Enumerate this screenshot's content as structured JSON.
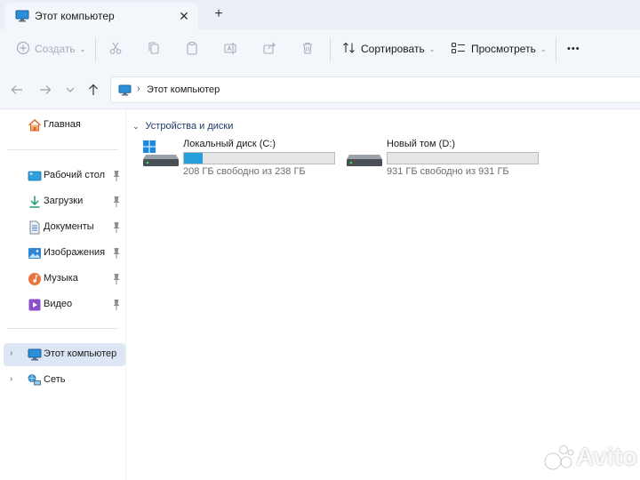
{
  "window": {
    "tab_title": "Этот компьютер",
    "tab_close": "✕",
    "new_tab": "+"
  },
  "toolbar": {
    "create_label": "Создать",
    "sort_label": "Сортировать",
    "view_label": "Просмотреть",
    "more_label": "•••"
  },
  "address": {
    "path": "Этот компьютер"
  },
  "sidebar": {
    "home": "Главная",
    "quick_access": [
      {
        "label": "Рабочий стол"
      },
      {
        "label": "Загрузки"
      },
      {
        "label": "Документы"
      },
      {
        "label": "Изображения"
      },
      {
        "label": "Музыка"
      },
      {
        "label": "Видео"
      }
    ],
    "this_pc": "Этот компьютер",
    "network": "Сеть"
  },
  "content": {
    "group_title": "Устройства и диски",
    "drives": [
      {
        "name": "Локальный диск (C:)",
        "free_text": "208 ГБ свободно из 238 ГБ",
        "used_fraction": 0.126
      },
      {
        "name": "Новый том (D:)",
        "free_text": "931 ГБ свободно из 931 ГБ",
        "used_fraction": 0.0
      }
    ]
  },
  "watermark": {
    "text": "Avito"
  },
  "colors": {
    "accent": "#26a0da",
    "chrome": "#f3f6fb",
    "selection": "#dde6f4"
  }
}
